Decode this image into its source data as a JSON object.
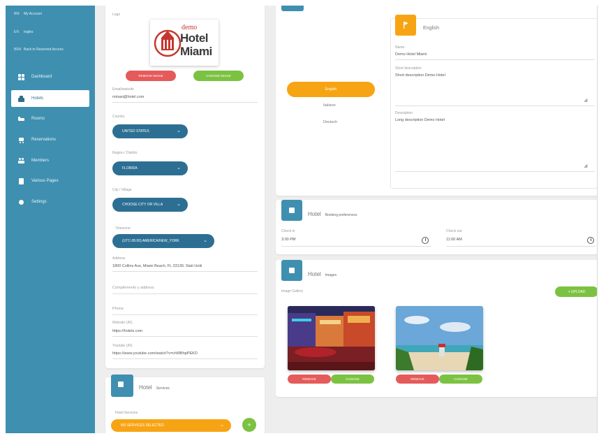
{
  "sidebar": {
    "top_items": [
      {
        "tag": "BM",
        "label": "My Account"
      },
      {
        "tag": "EN",
        "label": "Ingles"
      },
      {
        "tag": "BRA",
        "label": "Back to Reserved Access"
      }
    ],
    "items": [
      {
        "label": "Dashboard",
        "icon": "dashboard-icon"
      },
      {
        "label": "Hotels",
        "icon": "hotel-icon",
        "active": true
      },
      {
        "label": "Rooms",
        "icon": "bed-icon"
      },
      {
        "label": "Reservations",
        "icon": "cart-icon"
      },
      {
        "label": "Members",
        "icon": "people-icon"
      },
      {
        "label": "Various Pages",
        "icon": "page-icon"
      },
      {
        "label": "Settings",
        "icon": "gear-icon"
      }
    ]
  },
  "hotel_form": {
    "logo_label": "Logo",
    "logo_text_top": "demo",
    "logo_text_mid": "Hotel",
    "logo_text_bot": "Miami",
    "remove_image": "REMOVE IMAGE",
    "change_image": "CHOOSE IMAGE",
    "email_label": "Email/website",
    "email_value": "minasi@hotel.com",
    "country_label": "Country",
    "country_value": "UNITED STATES",
    "region_label": "Region / Distrito",
    "region_value": "FLORIDA",
    "city_label": "City / Village",
    "city_value": "CHOOSE CITY OR VILLA",
    "timezone_label": "Timezone",
    "timezone_value": "(UTC-05:00) AMERICA/NEW_YORK",
    "address_label": "Address",
    "address_value": "1800 Collins Ave, Miami Beach, FL 33139, Stati Uniti",
    "complement_label": "Complemento y address",
    "phone_label": "Phone",
    "website_label": "Website URL",
    "website_value": "https://hotels.com",
    "youtube_label": "Youtube URL",
    "youtube_value": "https://www.youtube.com/watch?v=chWBhpPEKD"
  },
  "services": {
    "title": "Hotel",
    "subtitle": "Services",
    "field_label": "Hotel Services",
    "select_value": "NO SERVICES SELECTED",
    "add_label": "+"
  },
  "languages": {
    "active": "English",
    "others": [
      "Italiano",
      "Deutsch"
    ],
    "header": "English",
    "name_label": "Name",
    "name_value": "Demo Hotel Miami",
    "short_desc_label": "Short description",
    "short_desc_value": "Short description Demo Hotel",
    "desc_label": "Description",
    "desc_value": "Long description Demo Hotel"
  },
  "booking": {
    "title": "Hotel",
    "subtitle": "Booking preferences",
    "checkin_label": "Check in",
    "checkin_value": "3:00 PM",
    "checkout_label": "Check out",
    "checkout_value": "11:00 AM"
  },
  "images": {
    "title": "Hotel",
    "subtitle": "Images",
    "gallery_label": "Image Gallery",
    "upload_label": "+ UPLOAD",
    "remove_label": "REMOVE",
    "choose_label": "CHOOSE"
  },
  "colors": {
    "sidebar": "#3f8fb0",
    "select": "#2d6f93",
    "orange": "#f7a414",
    "red": "#e55a5a",
    "green": "#7cc242"
  }
}
